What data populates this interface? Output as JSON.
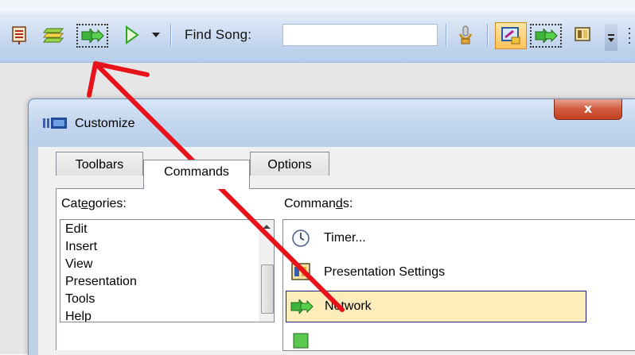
{
  "toolbar": {
    "find_label": "Find Song:",
    "find_value": "",
    "icons": [
      "song-list-icon",
      "layers-icon",
      "network-icon",
      "play-icon",
      "dropdown-arrow-icon",
      "microphone-icon",
      "presentation-settings-icon",
      "network-icon",
      "projector-icon",
      "overflow-chevron-icon"
    ]
  },
  "dialog": {
    "title": "Customize",
    "close_label": "x",
    "tabs": [
      {
        "label": "Toolbars"
      },
      {
        "label": "Commands"
      },
      {
        "label": "Options"
      }
    ],
    "active_tab": "Commands",
    "categories_label": "Categories:",
    "categories": [
      "Edit",
      "Insert",
      "View",
      "Presentation",
      "Tools",
      "Help"
    ],
    "commands_label": "Commands:",
    "commands": [
      {
        "label": "Timer...",
        "icon": "clock-icon"
      },
      {
        "label": "Presentation Settings",
        "icon": "presentation-settings-icon"
      },
      {
        "label": "Network",
        "icon": "network-icon",
        "selected": true
      },
      {
        "label": "",
        "icon": "green-icon"
      }
    ]
  },
  "annotation": {
    "color": "#e8131a"
  }
}
